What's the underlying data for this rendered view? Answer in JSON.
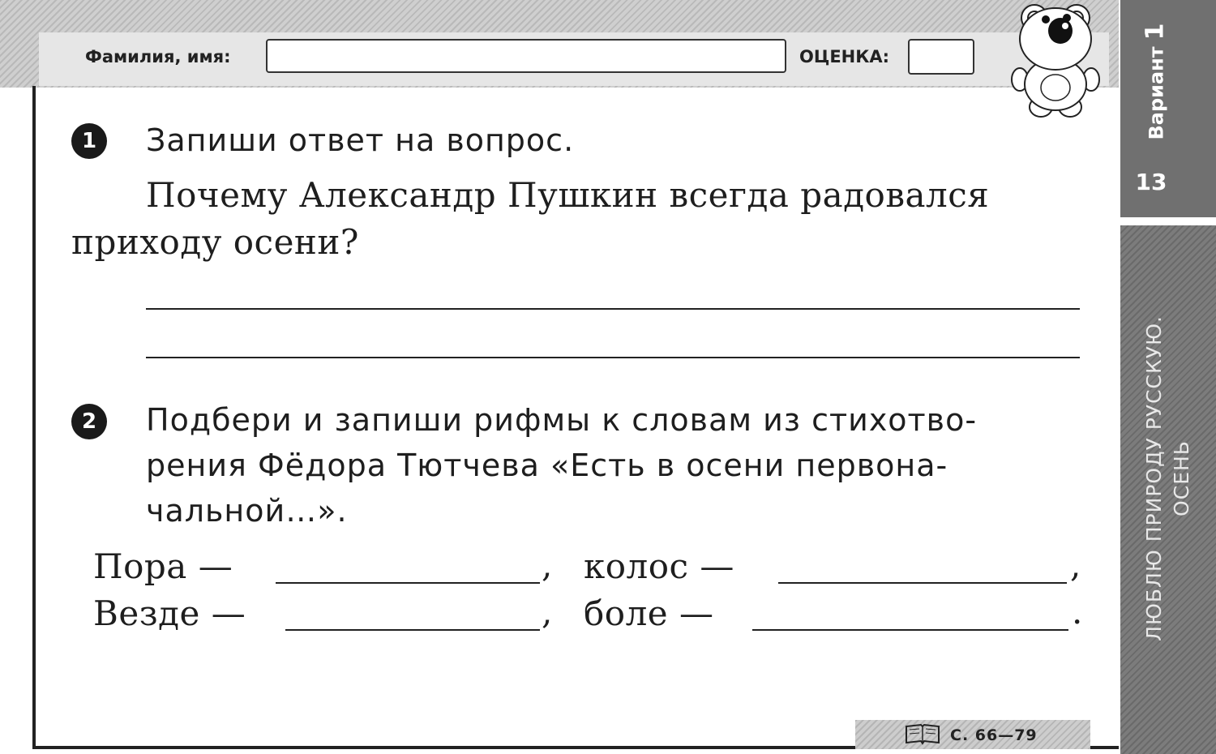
{
  "header": {
    "name_label": "Фамилия, имя:",
    "grade_label": "ОЦЕНКА:"
  },
  "sidebar": {
    "variant_label": "Вариант",
    "variant_number": "1",
    "page_number": "13",
    "section_title_line1": "ЛЮБЛЮ ПРИРОДУ РУССКУЮ.",
    "section_title_line2": "ОСЕНЬ"
  },
  "task1": {
    "number": "1",
    "instruction": "Запиши ответ на вопрос.",
    "question_line1": "Почему Александр Пушкин всегда радовался",
    "question_line2": "приходу осени?"
  },
  "task2": {
    "number": "2",
    "instruction_line1": "Подбери и запиши рифмы к словам из стихотво-",
    "instruction_line2": "рения Фёдора Тютчева «Есть в осени первона-",
    "instruction_line3": "чальной…».",
    "word1": "Пора —",
    "word2": "колос —",
    "word3": "Везде —",
    "word4": "боле —",
    "comma": ",",
    "period": "."
  },
  "footer": {
    "page_ref": "С. 66—79"
  },
  "icons": {
    "bear": "bear-mascot-icon",
    "book": "book-icon"
  }
}
